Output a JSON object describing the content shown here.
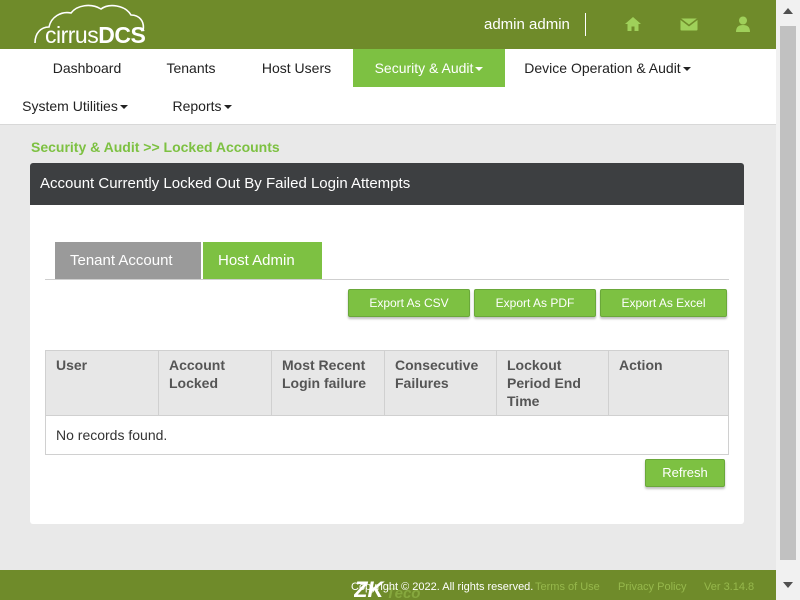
{
  "header": {
    "logo": {
      "light": "cirrus",
      "bold": "DCS"
    },
    "username": "admin admin",
    "icons": [
      "home-icon",
      "mail-icon",
      "user-icon"
    ]
  },
  "nav": {
    "items": [
      {
        "label": "Dashboard",
        "active": false,
        "dropdown": false
      },
      {
        "label": "Tenants",
        "active": false,
        "dropdown": false
      },
      {
        "label": "Host Users",
        "active": false,
        "dropdown": false
      },
      {
        "label": "Security & Audit",
        "active": true,
        "dropdown": true
      },
      {
        "label": "Device Operation & Audit",
        "active": false,
        "dropdown": true
      },
      {
        "label": "System Utilities",
        "active": false,
        "dropdown": true
      },
      {
        "label": "Reports",
        "active": false,
        "dropdown": true
      }
    ]
  },
  "breadcrumb": "Security & Audit >> Locked Accounts",
  "panel": {
    "title": "Account Currently Locked Out By Failed Login Attempts",
    "tabs": [
      {
        "label": "Tenant Account",
        "active": false
      },
      {
        "label": "Host Admin",
        "active": true
      }
    ],
    "export_buttons": [
      "Export As CSV",
      "Export As PDF",
      "Export As Excel"
    ],
    "table": {
      "columns": [
        "User",
        "Account Locked",
        "Most Recent Login failure",
        "Consecutive Failures",
        "Lockout Period End Time",
        "Action"
      ],
      "rows": [],
      "empty_text": "No records found."
    },
    "refresh_label": "Refresh"
  },
  "footer": {
    "copyright": "Copyright © 2022. All rights reserved.",
    "terms": "Terms of Use",
    "privacy": "Privacy Policy",
    "version": "Ver 3.14.8",
    "logo_text": "ZKTeco"
  },
  "colors": {
    "brand_dark": "#6f8b2a",
    "accent_green": "#7dc142",
    "panel_header": "#3d3f41",
    "tab_inactive": "#9a9a9a"
  }
}
